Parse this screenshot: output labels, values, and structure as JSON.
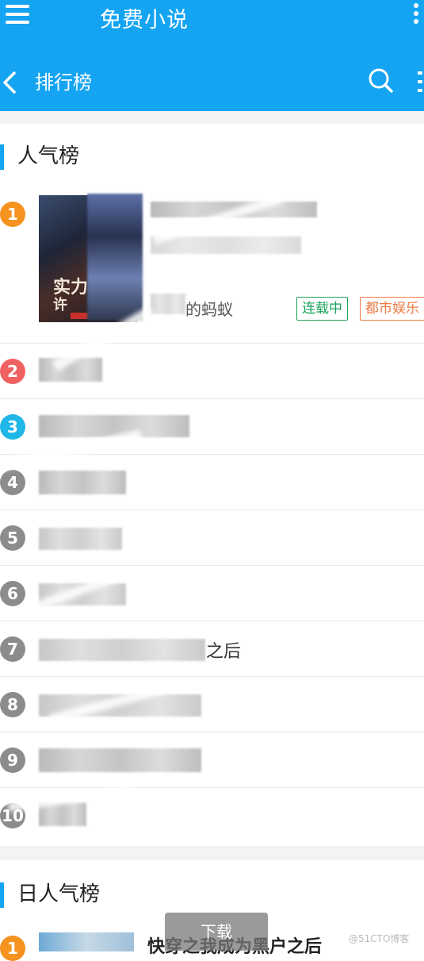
{
  "app": {
    "title": "免费小说"
  },
  "header": {
    "title": "排行榜"
  },
  "sections": [
    {
      "title": "人气榜"
    },
    {
      "title": "日人气榜"
    }
  ],
  "featured": {
    "rank": "1",
    "cover_text_line1": "实力",
    "cover_text_line2": "许",
    "author_suffix": "的蚂蚁",
    "status_tag": "连载中",
    "genre_tag": "都市娱乐"
  },
  "list": [
    {
      "rank": "2",
      "visible_text": ""
    },
    {
      "rank": "3",
      "visible_text": ""
    },
    {
      "rank": "4",
      "visible_text": ""
    },
    {
      "rank": "5",
      "visible_text": ""
    },
    {
      "rank": "6",
      "visible_text": ""
    },
    {
      "rank": "7",
      "visible_text": "之后"
    },
    {
      "rank": "8",
      "visible_text": ""
    },
    {
      "rank": "9",
      "visible_text": ""
    },
    {
      "rank": "10",
      "visible_text": ""
    }
  ],
  "daily_first": {
    "rank": "1",
    "title": "快穿之我成为黑户之后"
  },
  "download_label": "下载",
  "watermark": "@51CTO博客",
  "colors": {
    "accent": "#14a4f2",
    "rank1": "#f5931e",
    "rank2": "#f06262",
    "rank3": "#1fb6e8",
    "rank_other": "#8c8c8c"
  }
}
